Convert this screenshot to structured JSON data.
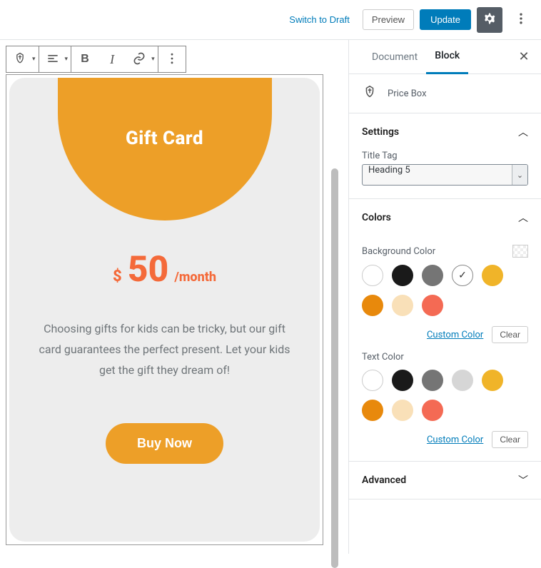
{
  "topbar": {
    "switch_draft": "Switch to Draft",
    "preview": "Preview",
    "update": "Update"
  },
  "toolbar": {
    "block_icon": "price-box-icon",
    "align_icon": "align-left-icon",
    "format": {
      "bold": "B",
      "italic": "I",
      "link": "link-icon"
    }
  },
  "card": {
    "title": "Gift Card",
    "currency": "$",
    "amount": "50",
    "period": "/month",
    "description": "Choosing gifts for kids can be tricky, but our gift card guarantees the perfect present. Let your kids get the gift they dream of!",
    "button": "Buy Now"
  },
  "sidebar": {
    "tabs": {
      "document": "Document",
      "block": "Block"
    },
    "block_type": "Price Box",
    "panels": {
      "settings": {
        "title": "Settings",
        "title_tag_label": "Title Tag",
        "title_tag_value": "Heading 5"
      },
      "colors": {
        "title": "Colors",
        "bg_label": "Background Color",
        "text_label": "Text Color",
        "custom": "Custom Color",
        "clear": "Clear",
        "palette": [
          {
            "hex": "#ffffff",
            "bordered": true
          },
          {
            "hex": "#1a1a1a"
          },
          {
            "hex": "#757575"
          },
          {
            "hex": "selected",
            "bordered": true
          },
          {
            "hex": "#f0b429"
          },
          {
            "hex": "#e8890c"
          },
          {
            "hex": "#f9e0b8"
          },
          {
            "hex": "#f46a54"
          }
        ],
        "palette_text": [
          {
            "hex": "#ffffff",
            "bordered": true
          },
          {
            "hex": "#1a1a1a"
          },
          {
            "hex": "#757575"
          },
          {
            "hex": "#d6d6d6"
          },
          {
            "hex": "#f0b429"
          },
          {
            "hex": "#e8890c"
          },
          {
            "hex": "#f9e0b8"
          },
          {
            "hex": "#f46a54"
          }
        ]
      },
      "advanced": {
        "title": "Advanced"
      }
    }
  }
}
